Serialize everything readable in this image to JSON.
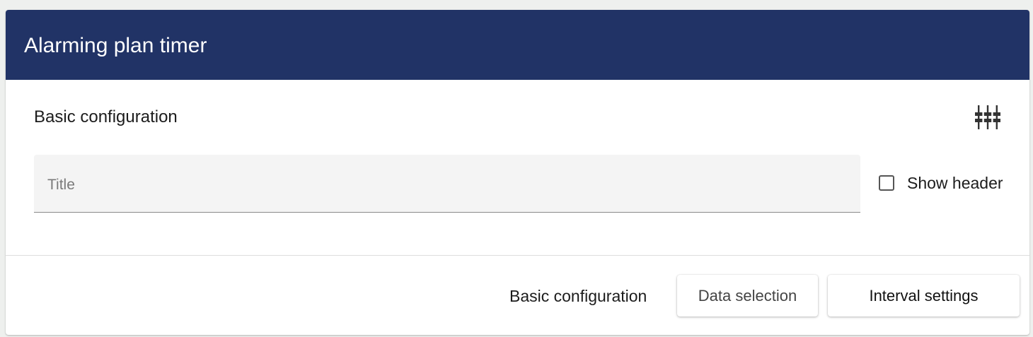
{
  "dialog": {
    "title": "Alarming plan timer",
    "header_color": "#213366"
  },
  "section": {
    "title": "Basic configuration",
    "settings_icon": "sliders-icon"
  },
  "title_field": {
    "placeholder": "Title",
    "value": ""
  },
  "show_header": {
    "label": "Show header",
    "checked": false
  },
  "footer": {
    "current_step_label": "Basic configuration",
    "data_selection_label": "Data selection",
    "interval_settings_label": "Interval settings"
  }
}
